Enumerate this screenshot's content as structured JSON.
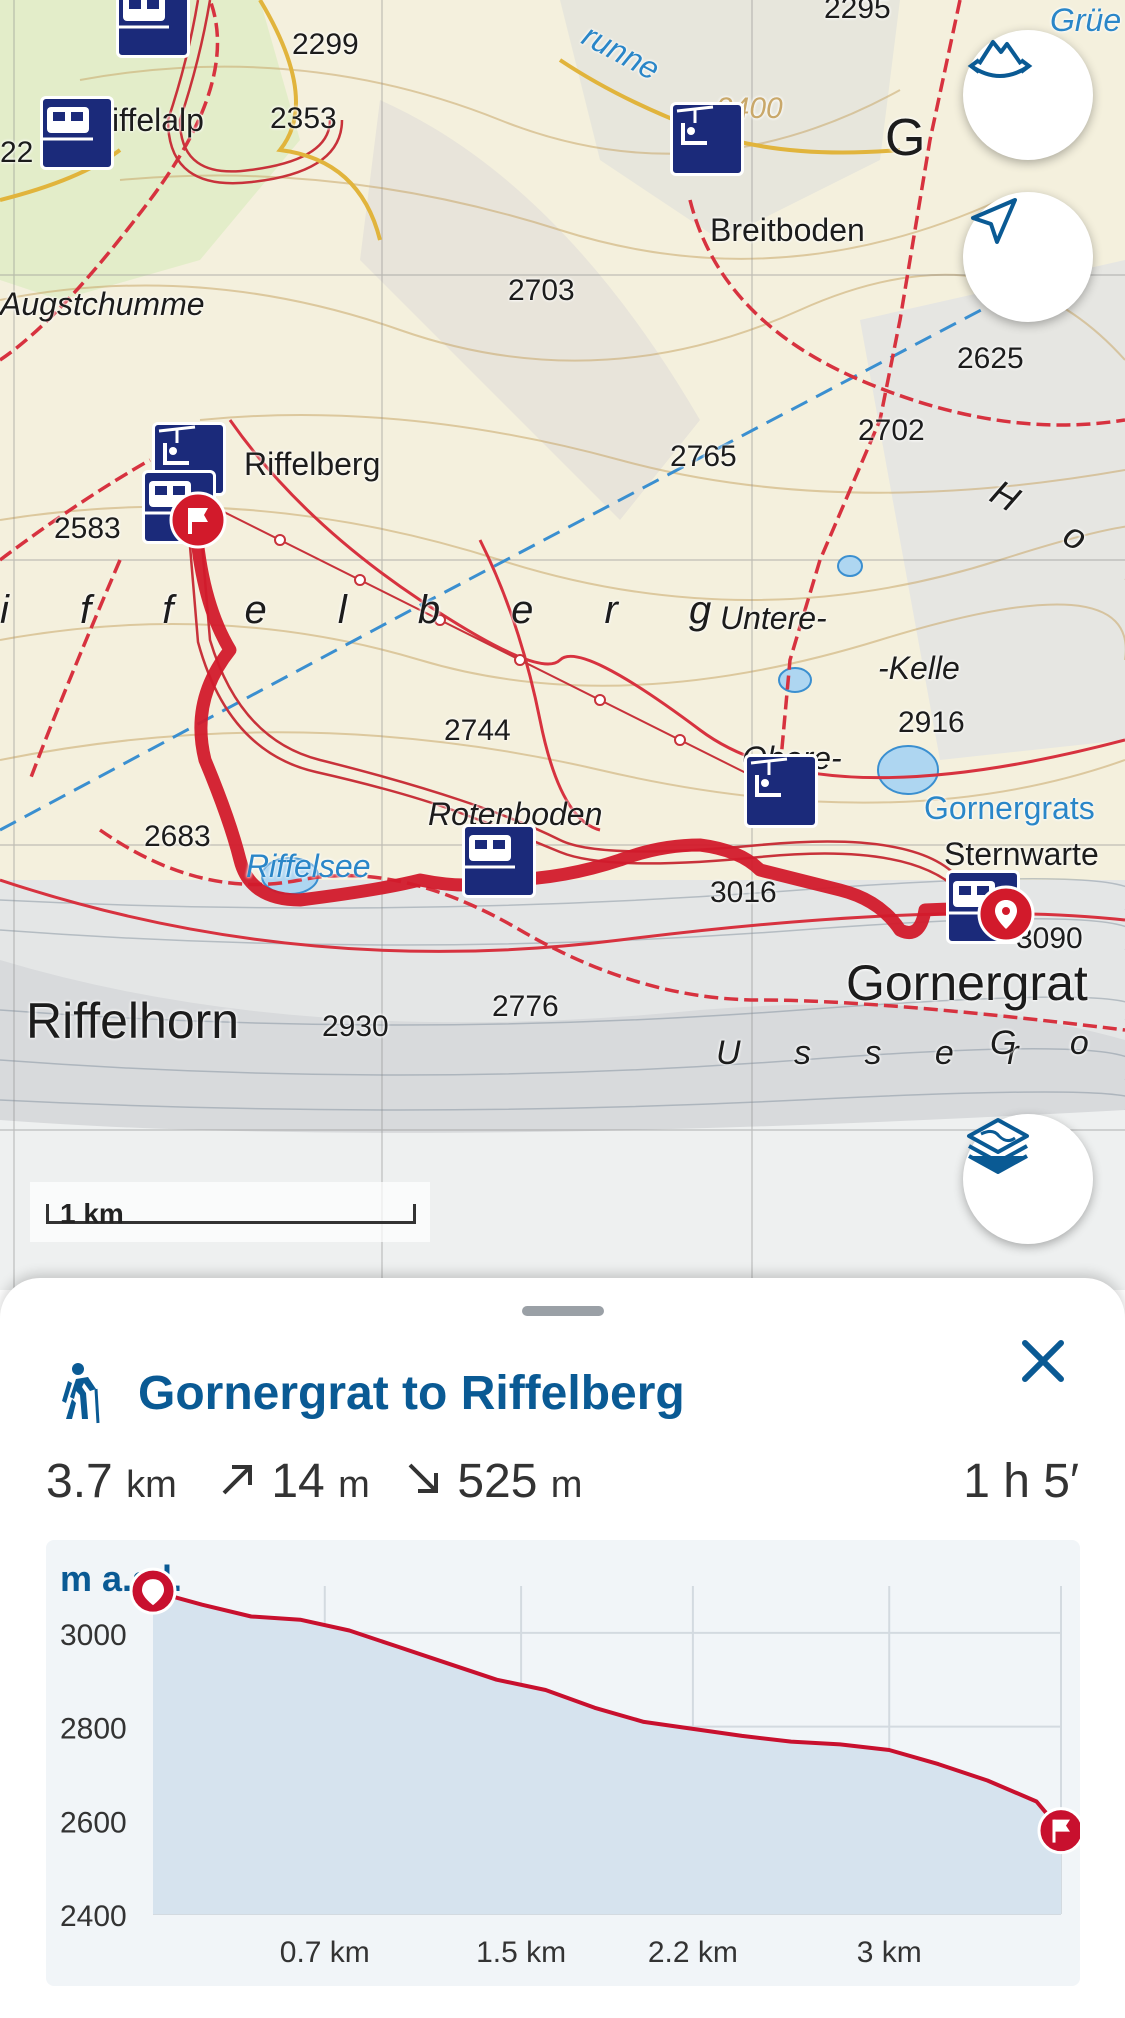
{
  "map": {
    "labels": {
      "riffelalp": "iffelalp",
      "alt_2299": "2299",
      "alt_2353": "2353",
      "alt_2295": "2295",
      "alt_22": "22",
      "grunne": "runne",
      "grue": "Grüe",
      "alt_2400": "2400",
      "g_letter": "G",
      "breitboden": "Breitboden",
      "augstchumme": "Augstchumme",
      "alt_2703": "2703",
      "alt_2625": "2625",
      "alt_2702": "2702",
      "alt_2765": "2765",
      "riffelberg": "Riffelberg",
      "alt_2583": "2583",
      "hoh": "H o h",
      "riffelberg_spaced": "i f f e l b e r g",
      "untere": "Untere-",
      "kelle": "-Kelle",
      "alt_2916": "2916",
      "alt_2744": "2744",
      "obere": "Obere-",
      "gornergrats": "Gornergrats",
      "sternwarte": "Sternwarte",
      "rotenboden": "Rotenboden",
      "alt_2683": "2683",
      "riffelsee": "Riffelsee",
      "alt_3016": "3016",
      "alt_3090": "3090",
      "gornergrat": "Gornergrat",
      "riffelhorn": "Riffelhorn",
      "alt_2930": "2930",
      "alt_2776": "2776",
      "usser": "U s s e r",
      "gor": "G o r"
    },
    "scale_label": "1 km",
    "buttons": {
      "view_3d": "mountain-rotate-icon",
      "locate": "navigation-arrow-icon",
      "layers": "layers-icon"
    },
    "route_color": "#d21a2b",
    "poi_color": "#1b2a7a"
  },
  "sheet": {
    "title": "Gornergrat to Riffelberg",
    "activity_icon": "hiker-icon",
    "stats": {
      "distance_value": "3.7",
      "distance_unit": "km",
      "ascent_value": "14",
      "ascent_unit": "m",
      "descent_value": "525",
      "descent_unit": "m",
      "duration": "1 h 5′"
    }
  },
  "chart_data": {
    "type": "area",
    "title": "",
    "ylabel": "m a.s.l.",
    "xlabel": "",
    "ylim": [
      2400,
      3100
    ],
    "xlim": [
      0,
      3.7
    ],
    "yticks": [
      "3000",
      "2800",
      "2600",
      "2400"
    ],
    "yticks_values": [
      3000,
      2800,
      2600,
      2400
    ],
    "xticks": [
      "0.7 km",
      "1.5 km",
      "2.2 km",
      "3 km"
    ],
    "xticks_values": [
      0.7,
      1.5,
      2.2,
      3.0
    ],
    "series": [
      {
        "x": [
          0,
          0.2,
          0.4,
          0.6,
          0.8,
          1.0,
          1.2,
          1.4,
          1.6,
          1.8,
          2.0,
          2.2,
          2.4,
          2.6,
          2.8,
          3.0,
          3.2,
          3.4,
          3.6,
          3.7
        ],
        "y": [
          3089,
          3060,
          3035,
          3028,
          3005,
          2970,
          2935,
          2900,
          2878,
          2840,
          2810,
          2795,
          2780,
          2768,
          2762,
          2750,
          2720,
          2685,
          2640,
          2578
        ]
      }
    ],
    "grid": true,
    "line_color": "#c8102e",
    "fill_color": "#d6e3ee"
  }
}
